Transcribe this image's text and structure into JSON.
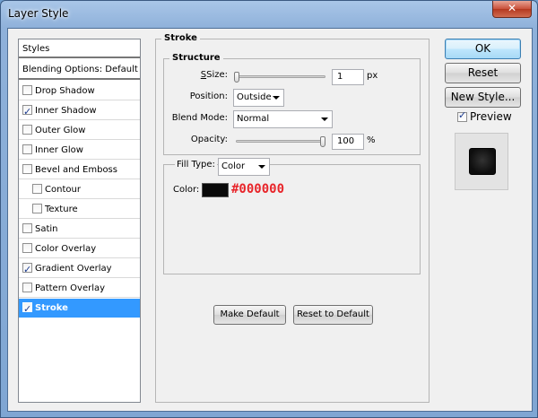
{
  "window": {
    "title": "Layer Style",
    "close_glyph": "✕"
  },
  "styles_list": {
    "header": "Styles",
    "blending": "Blending Options: Default",
    "items": [
      {
        "label": "Drop Shadow",
        "checked": false
      },
      {
        "label": "Inner Shadow",
        "checked": true
      },
      {
        "label": "Outer Glow",
        "checked": false
      },
      {
        "label": "Inner Glow",
        "checked": false
      },
      {
        "label": "Bevel and Emboss",
        "checked": false
      },
      {
        "label": "Contour",
        "checked": false
      },
      {
        "label": "Texture",
        "checked": false
      },
      {
        "label": "Satin",
        "checked": false
      },
      {
        "label": "Color Overlay",
        "checked": false
      },
      {
        "label": "Gradient Overlay",
        "checked": true
      },
      {
        "label": "Pattern Overlay",
        "checked": false
      },
      {
        "label": "Stroke",
        "checked": true,
        "selected": true
      }
    ]
  },
  "stroke": {
    "title": "Stroke",
    "structure_title": "Structure",
    "size_label": "Size:",
    "size_value": "1",
    "size_unit": "px",
    "size_fraction": 0.0,
    "position_label": "Position:",
    "position_value": "Outside",
    "blend_label": "Blend Mode:",
    "blend_value": "Normal",
    "opacity_label": "Opacity:",
    "opacity_value": "100",
    "opacity_unit": "%",
    "opacity_fraction": 1.0,
    "fill_type_label": "Fill Type:",
    "fill_type_value": "Color",
    "color_label": "Color:",
    "color_hex": "#000000",
    "color_swatch": "#0a0a0a",
    "make_default": "Make Default",
    "reset_default": "Reset to Default"
  },
  "right": {
    "ok": "OK",
    "reset": "Reset",
    "new_style": "New Style...",
    "preview_label": "Preview",
    "preview_checked": true
  },
  "colors": {
    "selection": "#3399ff",
    "hex_text": "#e8252a"
  }
}
